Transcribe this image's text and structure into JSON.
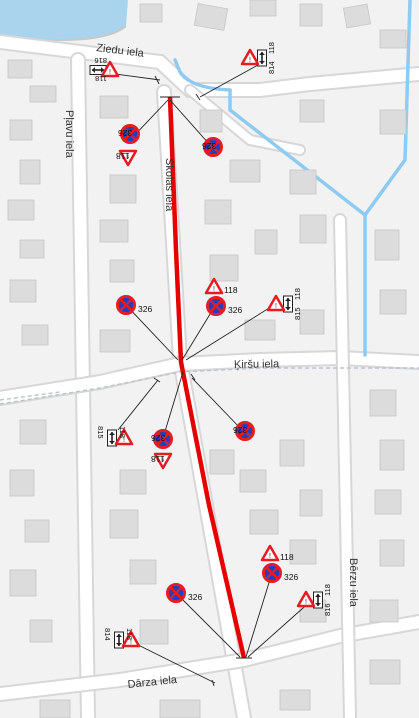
{
  "streets": {
    "ziedu": "Ziedu iela",
    "plavu": "Pļavu iela",
    "skolas": "Skolas iela",
    "kirsu": "Ķiršu iela",
    "berzu": "Bērzu iela",
    "darza": "Dārza iela"
  },
  "signs": {
    "no_stopping_code": "326",
    "warning_code": "118",
    "plate_814": "814",
    "plate_815": "815",
    "plate_816": "816"
  },
  "colors": {
    "highlight_route": "#e60000",
    "water": "#8ecbf2",
    "building": "#dddddd",
    "sign_blue": "#1f3fbf",
    "sign_red": "#e51c23"
  }
}
